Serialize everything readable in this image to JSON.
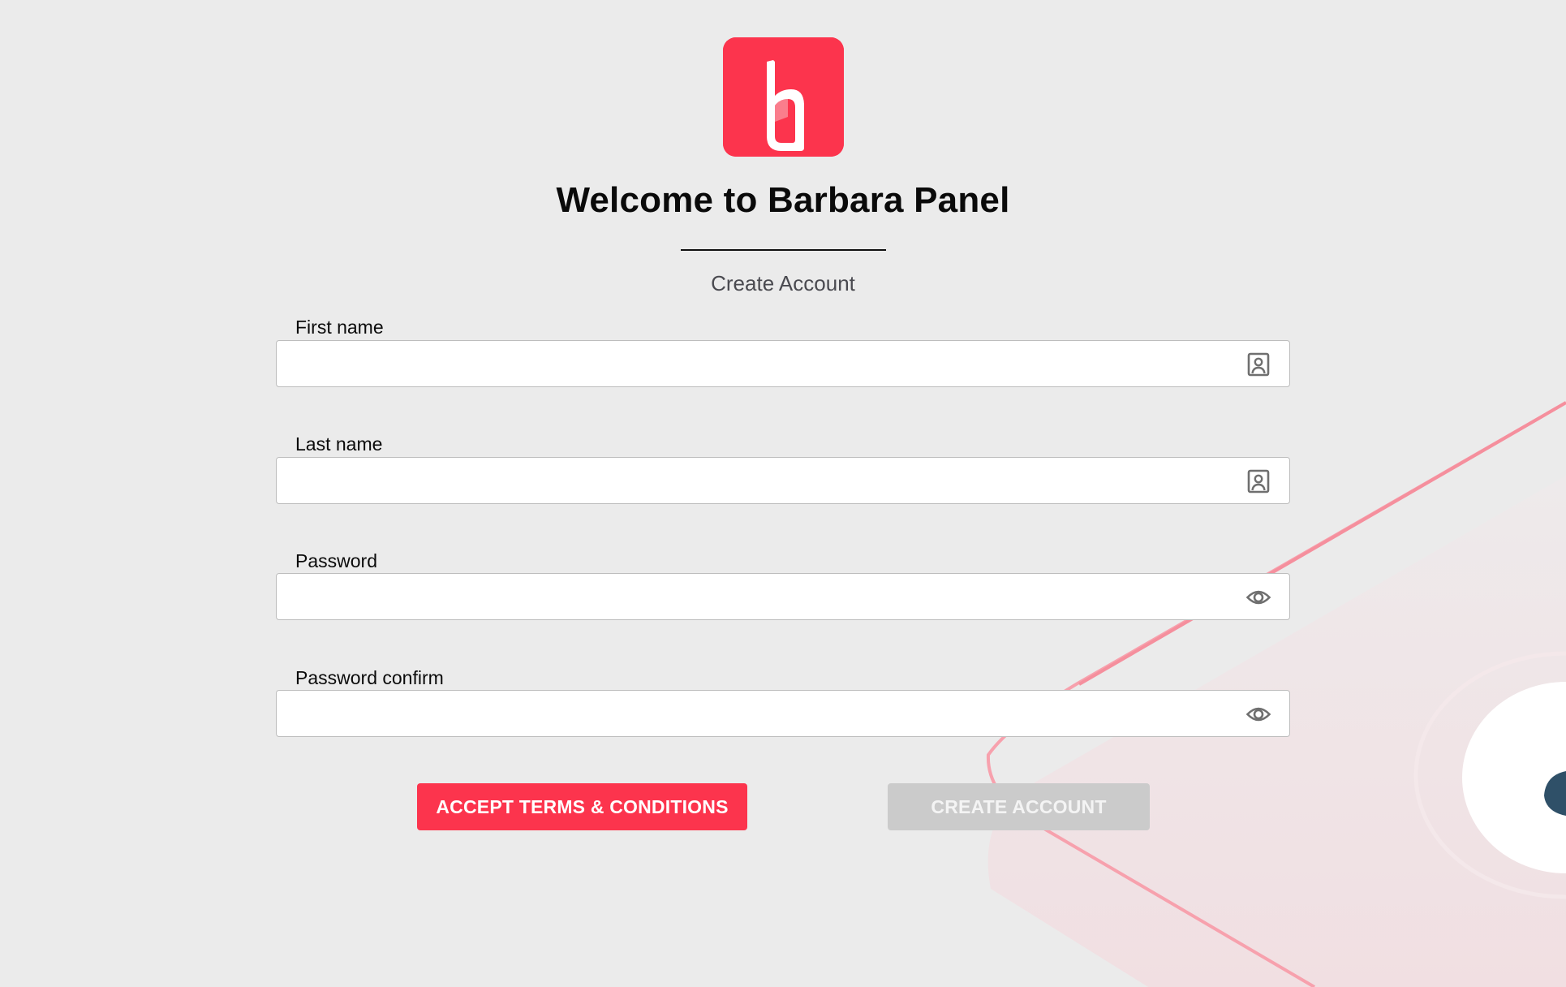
{
  "brand": {
    "logo_letter": "b",
    "accent_color": "#fc344d"
  },
  "header": {
    "title": "Welcome to Barbara Panel",
    "subtitle": "Create Account"
  },
  "form": {
    "fields": [
      {
        "label": "First name",
        "value": "",
        "placeholder": "",
        "icon": "contact-card-icon"
      },
      {
        "label": "Last name",
        "value": "",
        "placeholder": "",
        "icon": "contact-card-icon"
      },
      {
        "label": "Password",
        "value": "",
        "placeholder": "",
        "icon": "eye-icon"
      },
      {
        "label": "Password confirm",
        "value": "",
        "placeholder": "",
        "icon": "eye-icon"
      }
    ]
  },
  "actions": {
    "accept_label": "ACCEPT TERMS & CONDITIONS",
    "create_label": "CREATE ACCOUNT",
    "create_disabled": true
  }
}
